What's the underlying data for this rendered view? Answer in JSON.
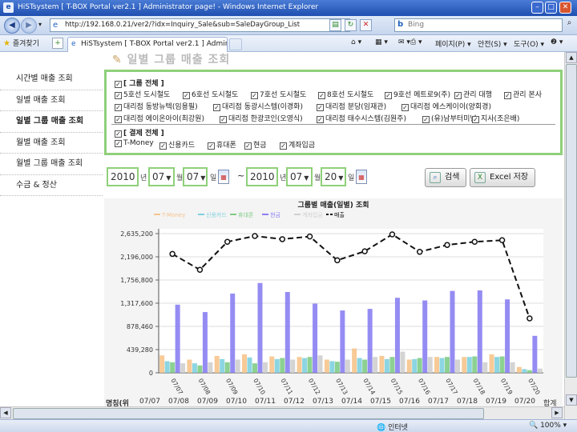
{
  "window": {
    "title": "HiSTsystem [ T-BOX Portal ver2.1 ] Administrator page! - Windows Internet Explorer"
  },
  "address_bar": {
    "url": "http://192.168.0.21/ver2/?idx=Inquiry_Sale&sub=SaleDayGroup_List",
    "search_placeholder": "Bing"
  },
  "favorites_bar": {
    "favorites_label": "즐겨찾기",
    "tab_title": "HiSTsystem [ T-BOX Portal ver2.1 ] Adminis...",
    "commands": [
      "페이지(P) ▾",
      "안전(S) ▾",
      "도구(O) ▾",
      "❷ ▾"
    ]
  },
  "page_heading": "일별 그룹 매출 조회",
  "sidebar": {
    "items": [
      {
        "label": "시간별 매출 조회",
        "active": false
      },
      {
        "label": "일별 매출 조회",
        "active": false
      },
      {
        "label": "일별 그룹 매출 조회",
        "active": true
      },
      {
        "label": "월별 매출 조회",
        "active": false
      },
      {
        "label": "월별 그룹 매출 조회",
        "active": false
      },
      {
        "label": "수금 & 정산",
        "active": false
      }
    ]
  },
  "filter": {
    "group_all_label": "[ 그룹 전체 ]",
    "groups": [
      "5호선 도시철도",
      "6호선 도시철도",
      "7호선 도시철도",
      "8호선 도시철도",
      "9호선 메트로9(주)",
      "관리 대행",
      "관리 본사",
      "대리점 동방뉴텍(임용필)",
      "대리점 동광시스템(이경화)",
      "대리점 분당(임재관)",
      "대리점 에스케이이(양회경)",
      "대리점 에이온아이(최강원)",
      "대리점 한광코인(오영식)",
      "대리점 태수시스템(김원주)",
      "(유)남부터미널",
      "지사(조은배)"
    ],
    "payment_all_label": "[ 결제 전체 ]",
    "payments": [
      "T-Money",
      "신용카드",
      "휴대폰",
      "현금",
      "계좌입금"
    ]
  },
  "date_range": {
    "from": {
      "year": "2010",
      "month": "07",
      "day": "07"
    },
    "to": {
      "year": "2010",
      "month": "07",
      "day": "20"
    },
    "unit_year": "년",
    "unit_month": "월",
    "unit_day": "일",
    "separator": "~"
  },
  "buttons": {
    "search": "검색",
    "excel": "Excel 저장"
  },
  "chart_data": {
    "type": "bar",
    "title": "그룹별 매출(일별) 조회",
    "categories": [
      "07/07",
      "07/08",
      "07/09",
      "07/10",
      "07/11",
      "07/12",
      "07/13",
      "07/14",
      "07/15",
      "07/16",
      "07/17",
      "07/18",
      "07/19",
      "07/20"
    ],
    "y_ticks": [
      "0",
      "439,280",
      "878,460",
      "1,317,600",
      "1,756,800",
      "2,196,000",
      "2,635,200"
    ],
    "ylim": [
      0,
      2635200
    ],
    "grid": true,
    "legend_position": "top",
    "series": [
      {
        "name": "T-Money",
        "kind": "bar",
        "color": "#f6c48c",
        "values": [
          330000,
          250000,
          320000,
          350000,
          310000,
          300000,
          250000,
          460000,
          320000,
          250000,
          300000,
          300000,
          350000,
          110000
        ]
      },
      {
        "name": "신용카드",
        "kind": "bar",
        "color": "#7fd0df",
        "values": [
          220000,
          180000,
          260000,
          290000,
          260000,
          280000,
          220000,
          280000,
          260000,
          260000,
          280000,
          300000,
          300000,
          70000
        ]
      },
      {
        "name": "휴대폰",
        "kind": "bar",
        "color": "#7fcc86",
        "values": [
          200000,
          140000,
          200000,
          180000,
          280000,
          300000,
          210000,
          250000,
          300000,
          280000,
          300000,
          310000,
          310000,
          50000
        ]
      },
      {
        "name": "현금",
        "kind": "bar",
        "color": "#8a80f2",
        "values": [
          1290000,
          1150000,
          1500000,
          1700000,
          1530000,
          1310000,
          1180000,
          1210000,
          1420000,
          1370000,
          1550000,
          1560000,
          1390000,
          700000
        ]
      },
      {
        "name": "계좌입금",
        "kind": "bar",
        "color": "#cfcfcf",
        "values": [
          180000,
          200000,
          250000,
          200000,
          250000,
          330000,
          250000,
          300000,
          400000,
          300000,
          250000,
          200000,
          200000,
          80000
        ]
      },
      {
        "name": "매출",
        "kind": "line",
        "color": "#111111",
        "values": [
          2250000,
          1950000,
          2480000,
          2590000,
          2530000,
          2580000,
          2130000,
          2300000,
          2620000,
          2290000,
          2420000,
          2480000,
          2510000,
          1030000
        ]
      }
    ]
  },
  "table_strip": {
    "row_label": "명칭(위",
    "cells": [
      "07/07",
      "07/08",
      "07/09",
      "07/10",
      "07/11",
      "07/12",
      "07/13",
      "07/14",
      "07/15",
      "07/16",
      "07/17",
      "07/18",
      "07/19",
      "07/20",
      "합계"
    ]
  },
  "status_bar": {
    "zone": "인터넷",
    "zoom": "100%"
  }
}
